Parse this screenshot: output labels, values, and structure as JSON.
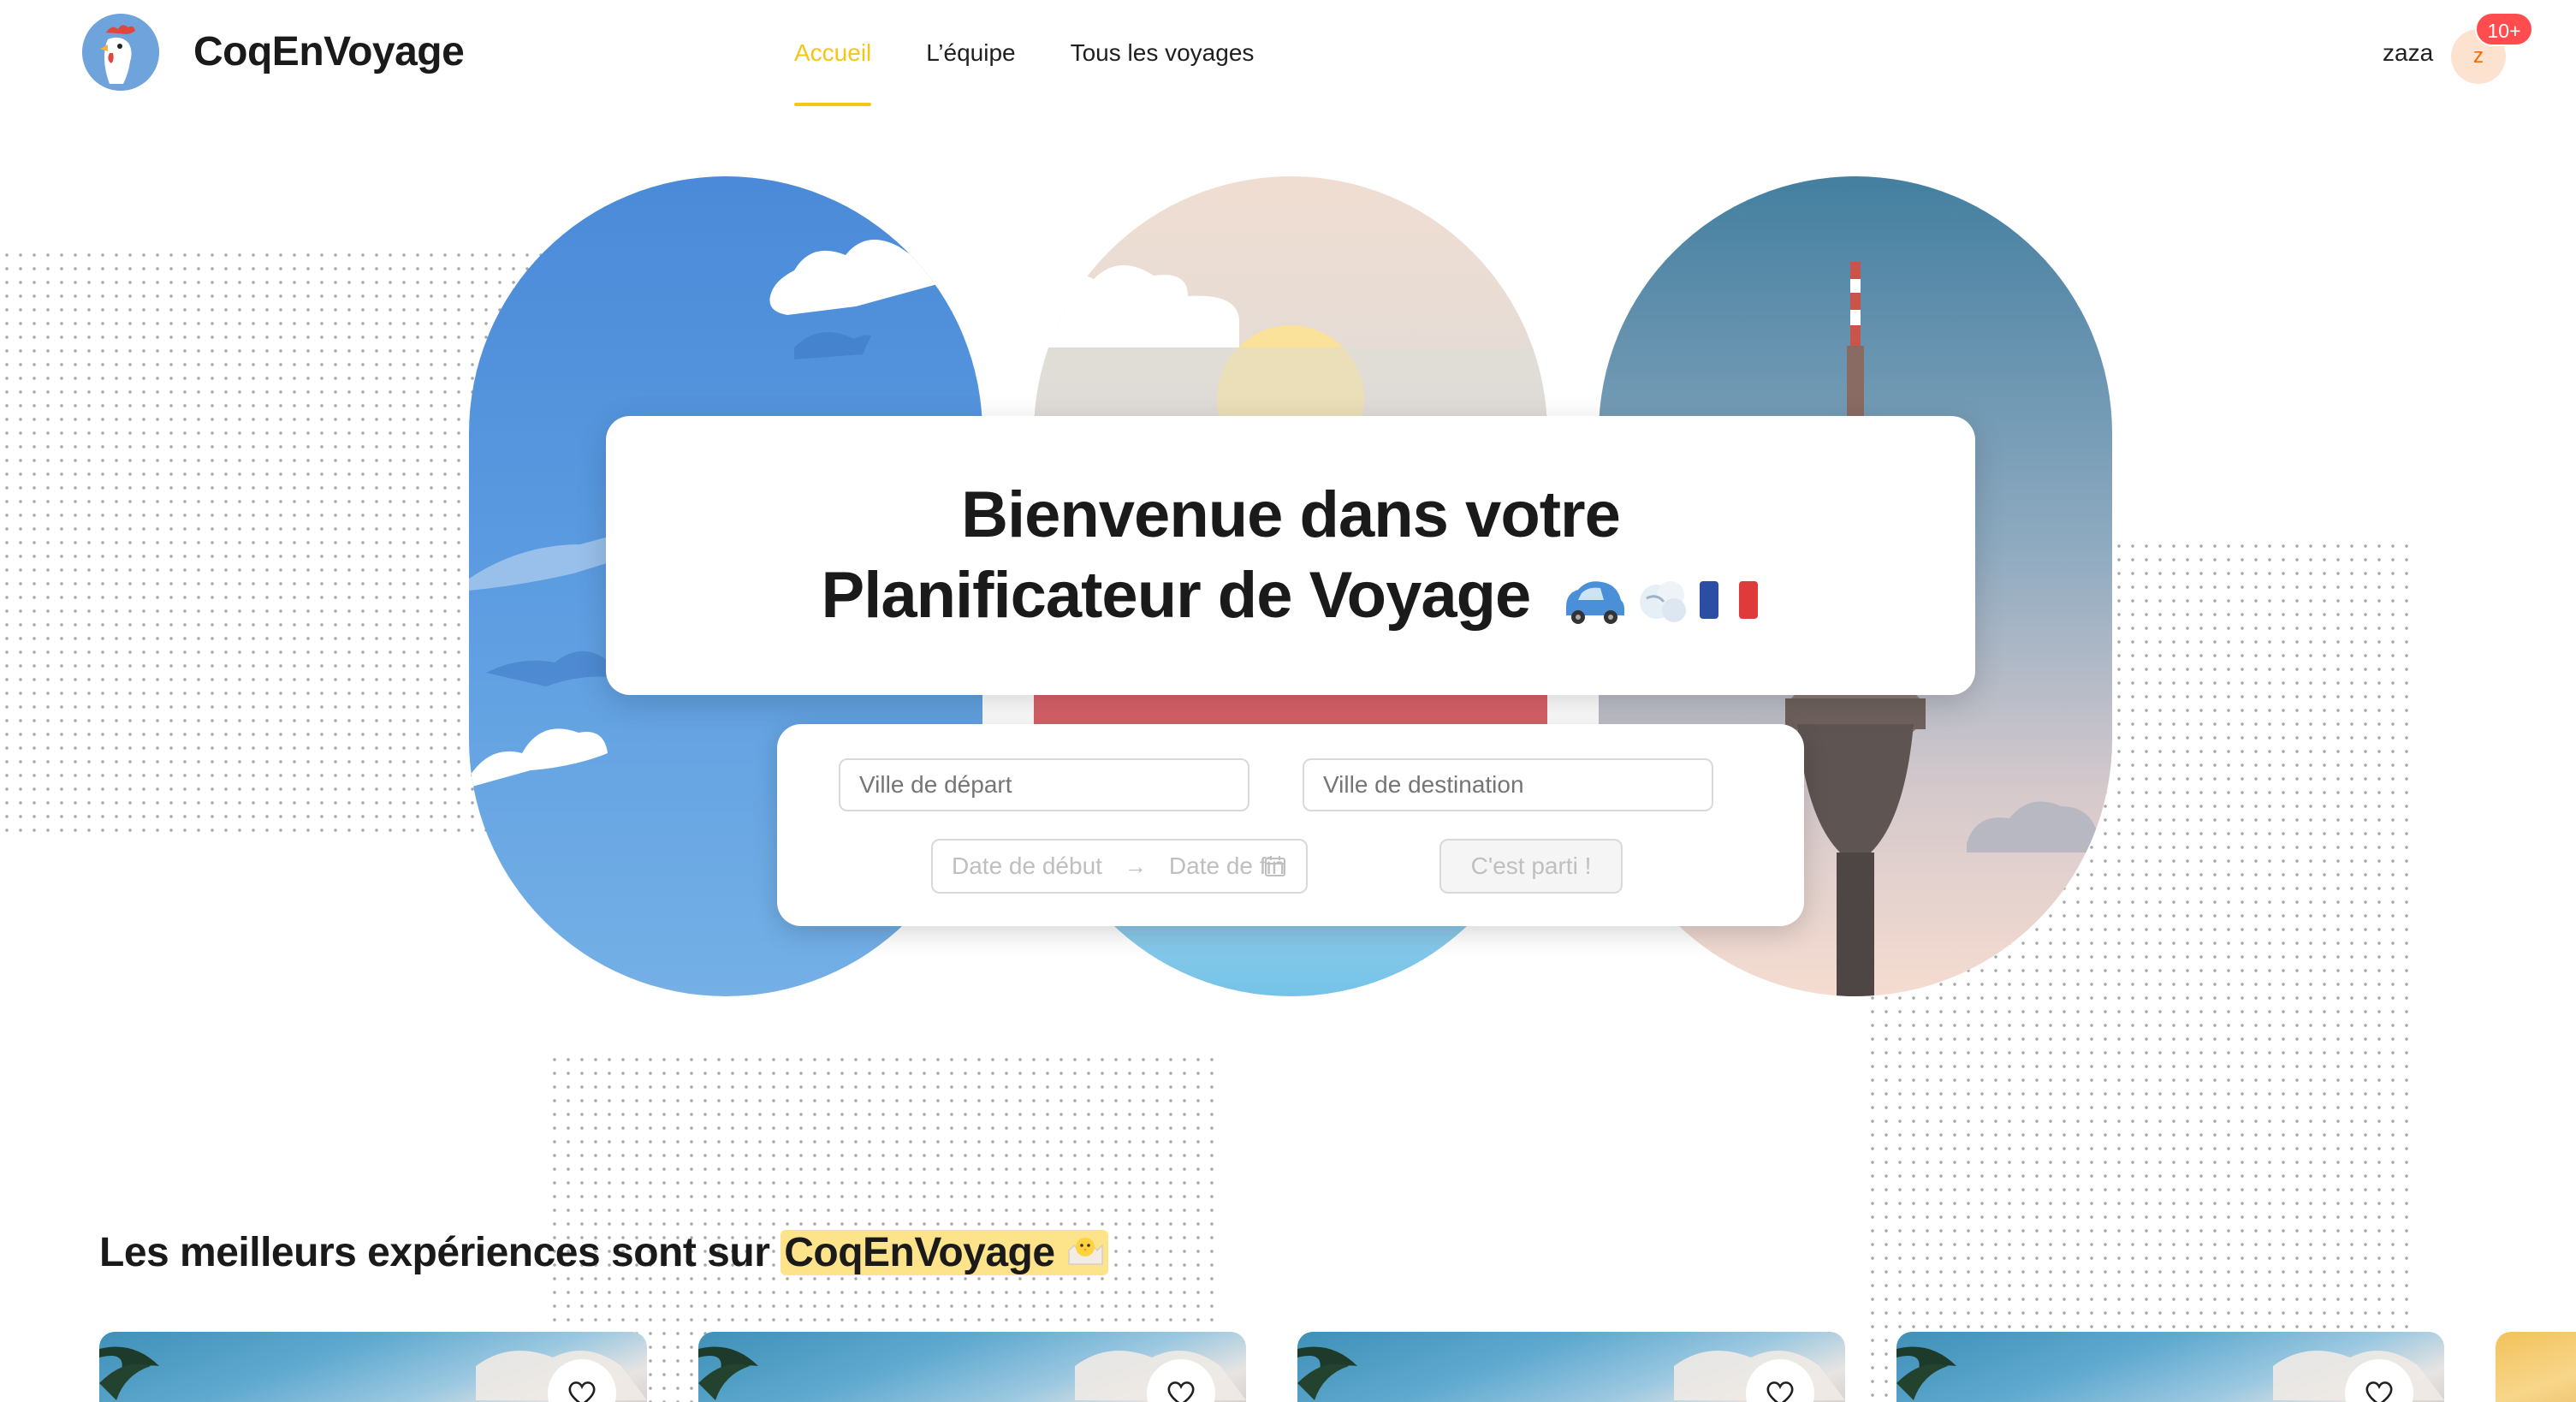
{
  "header": {
    "brand": "CoqEnVoyage",
    "nav": [
      {
        "label": "Accueil",
        "active": true
      },
      {
        "label": "L’équipe",
        "active": false
      },
      {
        "label": "Tous les voyages",
        "active": false
      }
    ],
    "user": {
      "name": "zaza",
      "avatar_initial": "z",
      "badge": "10+"
    }
  },
  "hero": {
    "title_line1": "Bienvenue dans votre",
    "title_line2": "Planificateur de Voyage",
    "title_emojis": [
      "car-icon",
      "dash-icon",
      "france-flag-icon"
    ]
  },
  "search": {
    "departure_placeholder": "Ville de départ",
    "destination_placeholder": "Ville de destination",
    "start_date_placeholder": "Date de début",
    "end_date_placeholder": "Date de fin",
    "submit_label": "C'est parti !"
  },
  "experiences": {
    "title_prefix": "Les meilleurs expériences sont sur",
    "title_highlight": "CoqEnVoyage",
    "title_emoji": "hatching-chick-icon"
  },
  "colors": {
    "accent": "#f5c518",
    "badge": "#ff4d4f",
    "highlight": "#fde38a"
  }
}
